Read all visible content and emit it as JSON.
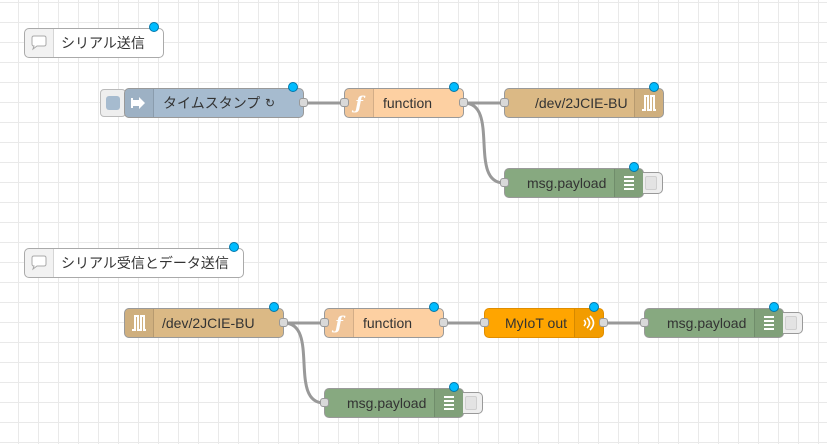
{
  "colors": {
    "inject": "#a6bbcf",
    "function": "#fdd0a2",
    "serial": "#dbb985",
    "debug": "#87a980",
    "myiot": "#ffa500",
    "comment": "#ffffff",
    "wire": "#999999",
    "changed_dot": "#00bcff"
  },
  "flow1": {
    "comment": {
      "label": "シリアル送信",
      "icon": "comment-icon"
    },
    "inject": {
      "label": "タイムスタンプ",
      "repeat_symbol": "↻",
      "icon": "arrow-in-icon"
    },
    "function": {
      "label": "function",
      "icon": "function-icon"
    },
    "serial_out": {
      "label": "/dev/2JCIE-BU",
      "icon": "serial-port-icon"
    },
    "debug": {
      "label": "msg.payload",
      "icon": "debug-list-icon"
    }
  },
  "flow2": {
    "comment": {
      "label": "シリアル受信とデータ送信",
      "icon": "comment-icon"
    },
    "serial_in": {
      "label": "/dev/2JCIE-BU",
      "icon": "serial-port-icon"
    },
    "function": {
      "label": "function",
      "icon": "function-icon"
    },
    "myiot": {
      "label": "MyIoT out",
      "icon": "wireless-icon"
    },
    "debug_a": {
      "label": "msg.payload",
      "icon": "debug-list-icon"
    },
    "debug_b": {
      "label": "msg.payload",
      "icon": "debug-list-icon"
    }
  }
}
